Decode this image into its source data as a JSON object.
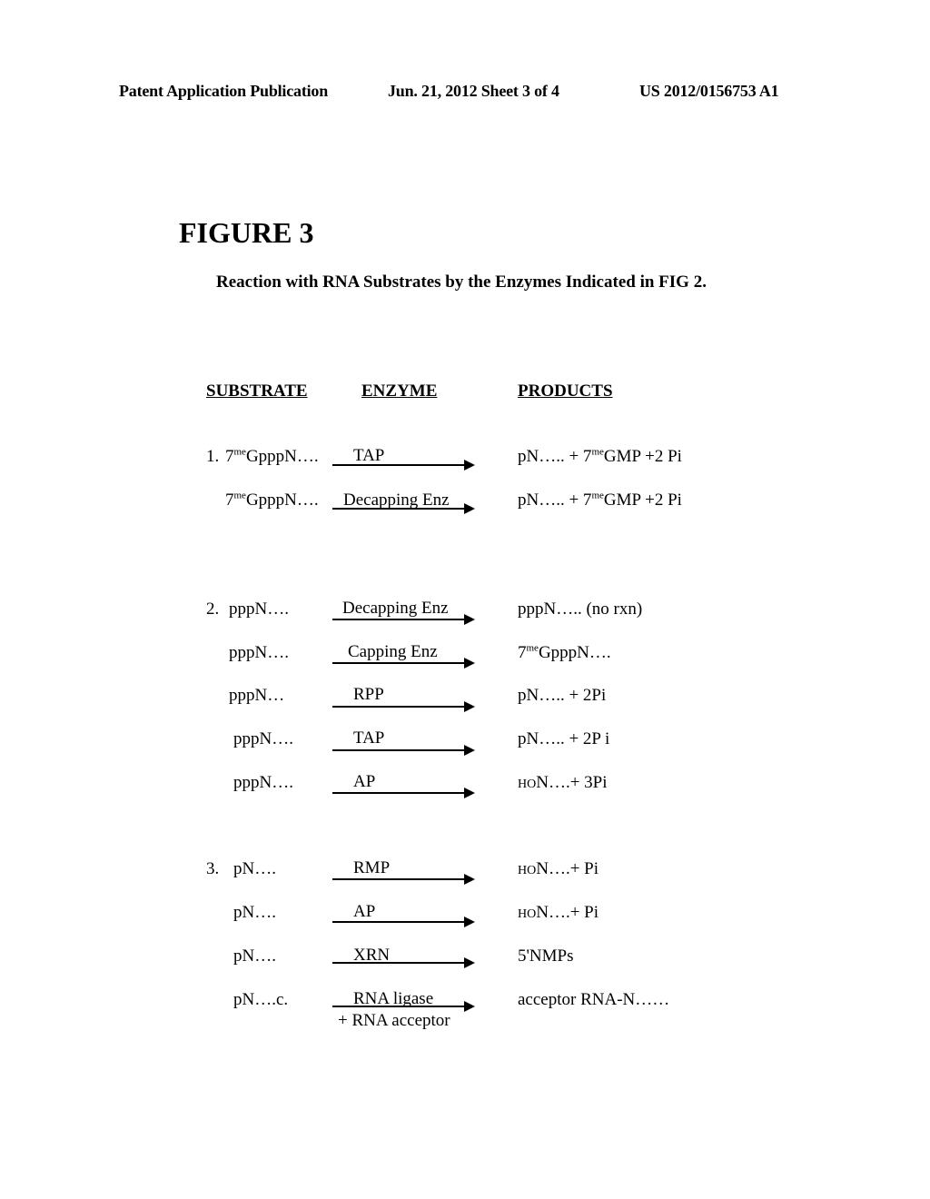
{
  "header": {
    "left": "Patent Application Publication",
    "middle": "Jun. 21, 2012  Sheet 3 of 4",
    "right": "US 2012/0156753 A1"
  },
  "figure": {
    "title": "FIGURE 3",
    "subtitle": "Reaction with RNA Substrates by the Enzymes Indicated in FIG 2."
  },
  "columns": {
    "substrate": "SUBSTRATE",
    "enzyme": "ENZYME",
    "products": "PRODUCTS"
  },
  "groups": [
    {
      "number": "1.",
      "rows": [
        {
          "substrate_pre": "7",
          "substrate_sup": "me",
          "substrate_post": "GpppN….",
          "enzyme": "TAP",
          "product_pre": "pN….. +  7",
          "product_sup": "me",
          "product_post": "GMP +2 Pi"
        },
        {
          "substrate_pre": "7",
          "substrate_sup": "me",
          "substrate_post": "GpppN….",
          "enzyme": "Decapping Enz",
          "product_pre": "pN….. +  7",
          "product_sup": "me",
          "product_post": "GMP +2 Pi"
        }
      ]
    },
    {
      "number": "2.",
      "rows": [
        {
          "substrate": "pppN….",
          "enzyme": "Decapping Enz",
          "product": "pppN…..   (no rxn)"
        },
        {
          "substrate": "pppN….",
          "enzyme": "Capping Enz",
          "product_pre": "7",
          "product_sup": "me",
          "product_post": "GpppN…."
        },
        {
          "substrate": "pppN…",
          "enzyme": "RPP",
          "product": "pN….. + 2Pi"
        },
        {
          "substrate": "pppN….",
          "enzyme": "TAP",
          "product": "pN….. + 2P i"
        },
        {
          "substrate": "pppN….",
          "enzyme": "AP",
          "product_small": "HO",
          "product_post": "N….+ 3Pi"
        }
      ]
    },
    {
      "number": "3.",
      "rows": [
        {
          "substrate": "pN….",
          "enzyme": "RMP",
          "product_small": "HO",
          "product_post": "N….+ Pi"
        },
        {
          "substrate": "pN….",
          "enzyme": "AP",
          "product_small": "HO",
          "product_post": "N….+ Pi"
        },
        {
          "substrate": "pN….",
          "enzyme": "XRN",
          "product": "5'NMPs"
        },
        {
          "substrate": "pN….c.",
          "enzyme": "RNA ligase",
          "enzyme_below": "+ RNA acceptor",
          "product": "acceptor RNA-N……"
        }
      ]
    }
  ]
}
